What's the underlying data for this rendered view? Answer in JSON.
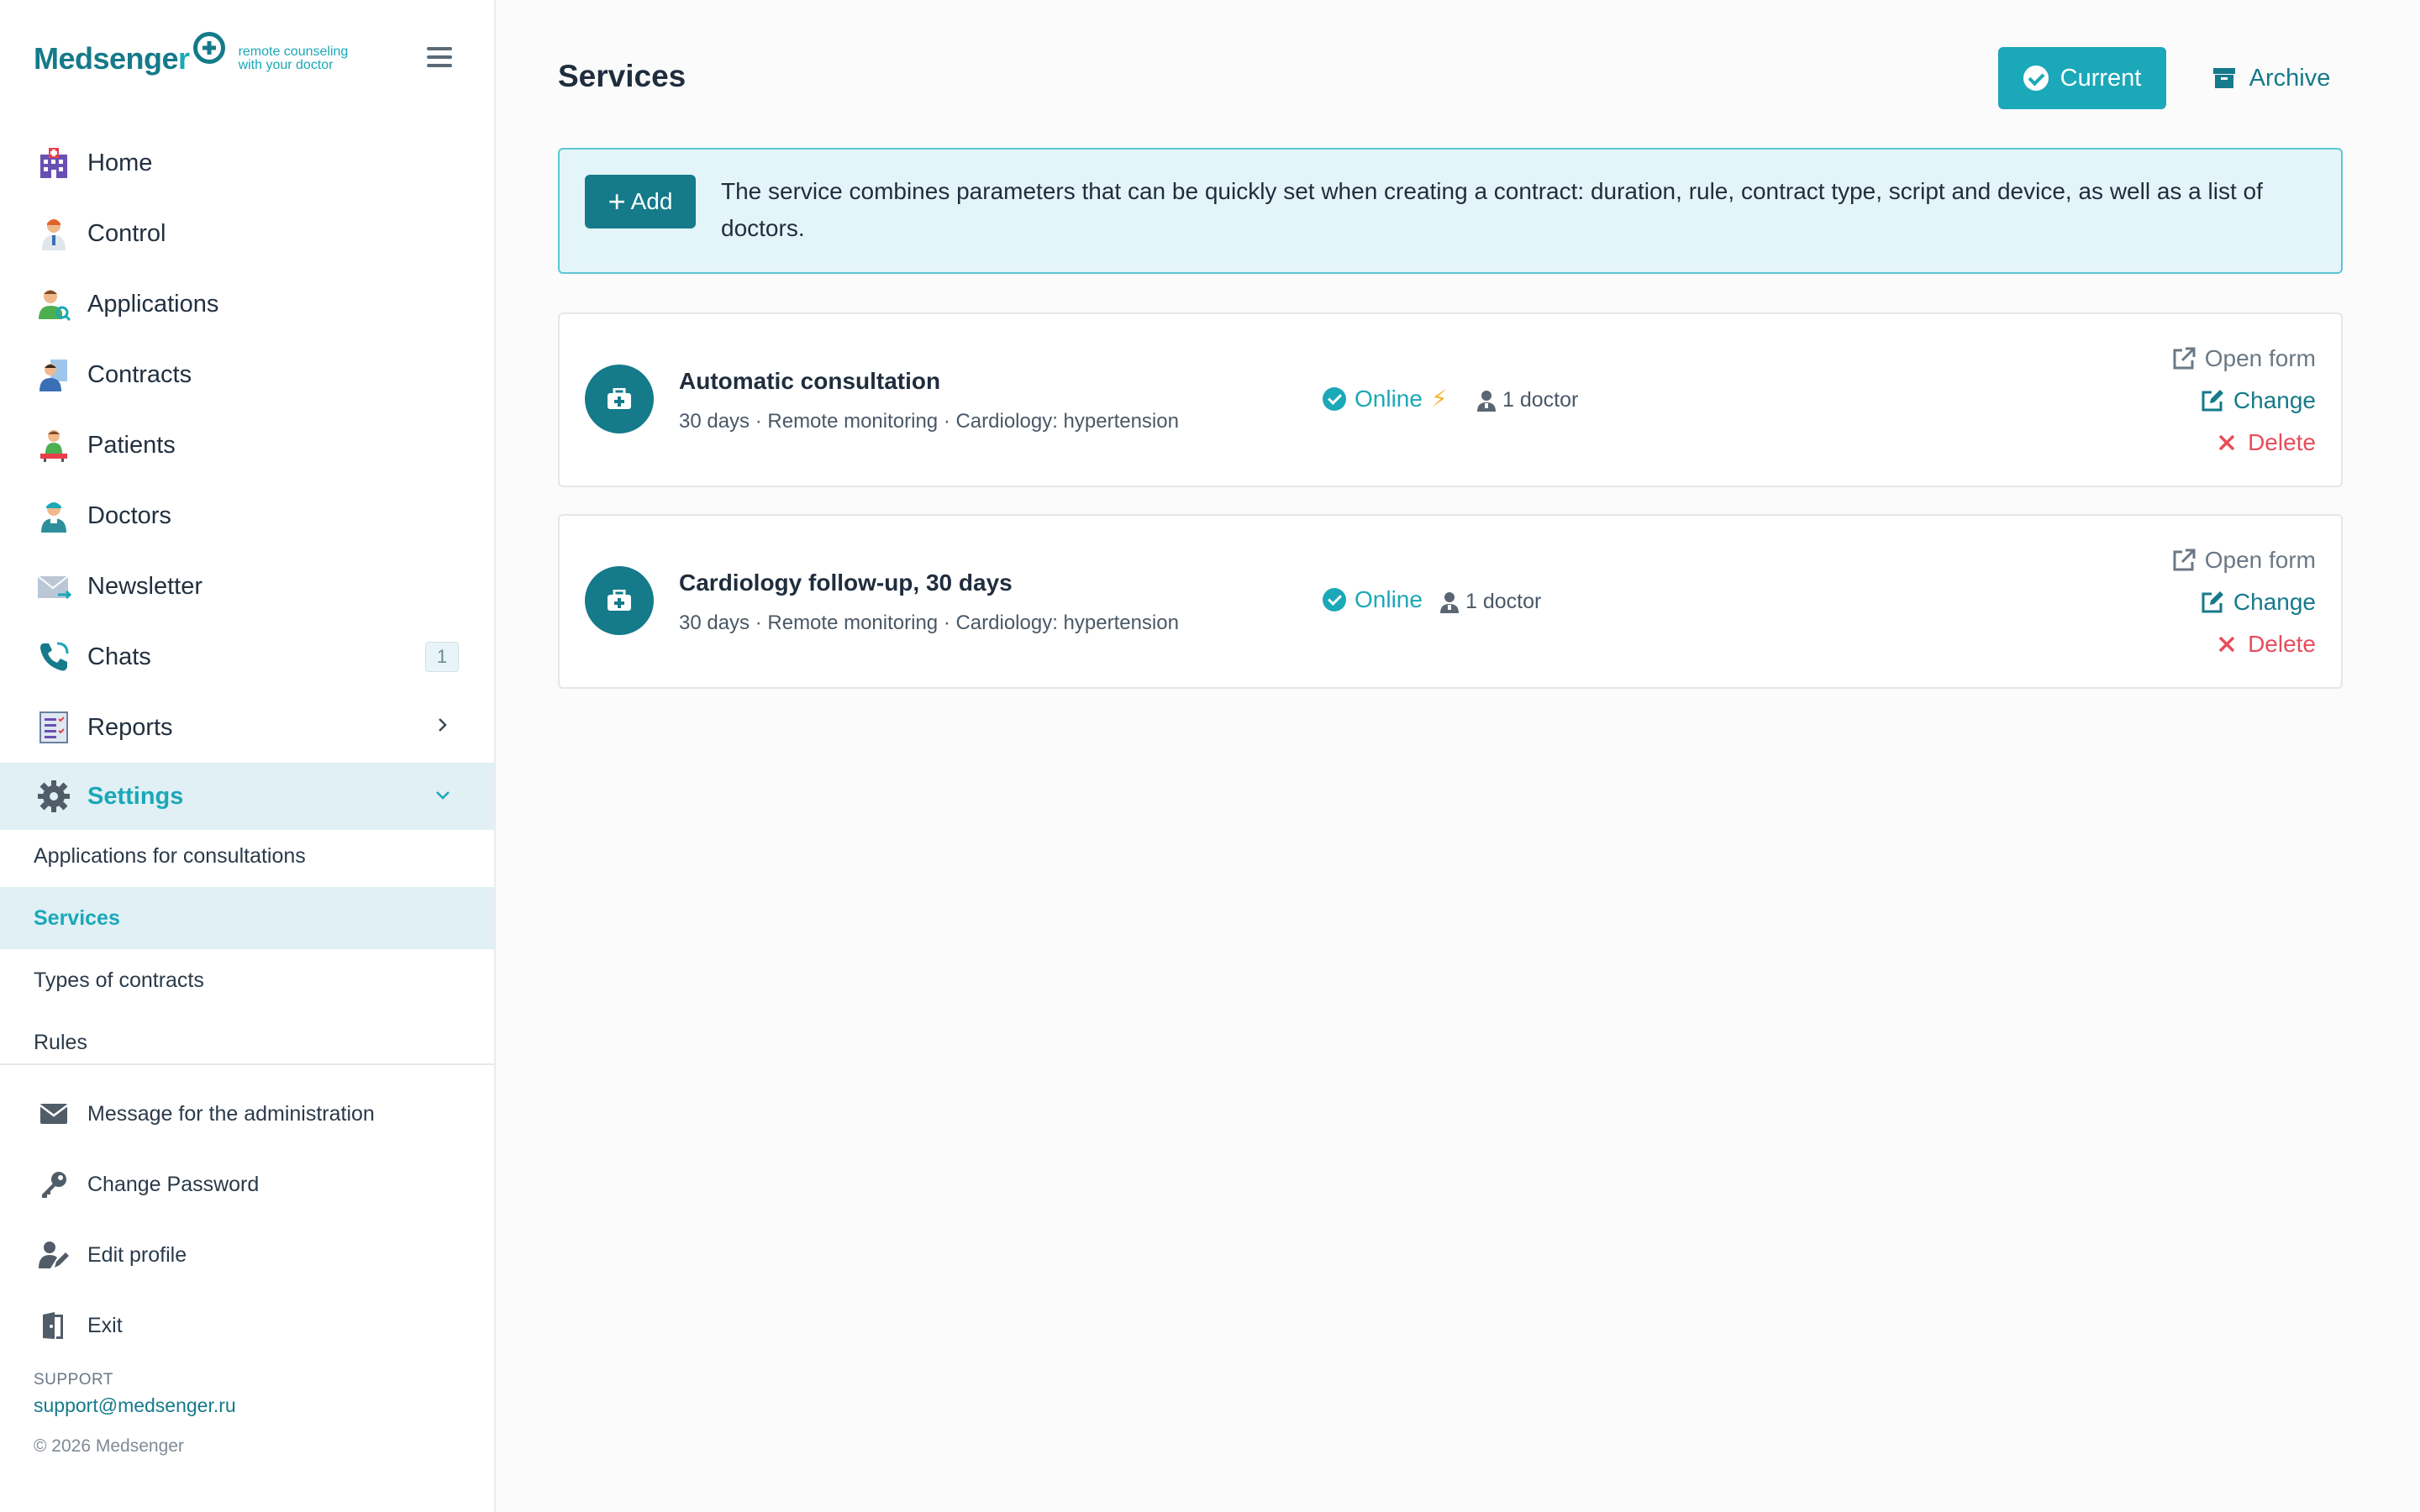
{
  "brand": {
    "name_part1": "Medsenge",
    "name_part2": "r",
    "tagline_line1": "remote counseling",
    "tagline_line2": "with your doctor"
  },
  "nav": {
    "items": [
      {
        "label": "Home",
        "icon": "hospital-icon"
      },
      {
        "label": "Control",
        "icon": "doctor-icon"
      },
      {
        "label": "Applications",
        "icon": "user-search-icon"
      },
      {
        "label": "Contracts",
        "icon": "contract-icon"
      },
      {
        "label": "Patients",
        "icon": "patient-icon"
      },
      {
        "label": "Doctors",
        "icon": "nurse-icon"
      },
      {
        "label": "Newsletter",
        "icon": "mail-icon"
      },
      {
        "label": "Chats",
        "icon": "phone-icon",
        "badge": "1"
      },
      {
        "label": "Reports",
        "icon": "report-icon"
      },
      {
        "label": "Settings",
        "icon": "gear-icon"
      }
    ],
    "settings_sub": [
      {
        "label": "Applications for consultations"
      },
      {
        "label": "Services"
      },
      {
        "label": "Types of contracts"
      },
      {
        "label": "Rules"
      }
    ],
    "aux": [
      {
        "label": "Message for the administration",
        "icon": "envelope-icon"
      },
      {
        "label": "Change Password",
        "icon": "key-icon"
      },
      {
        "label": "Edit profile",
        "icon": "user-edit-icon"
      },
      {
        "label": "Exit",
        "icon": "exit-icon"
      }
    ]
  },
  "support": {
    "caption": "SUPPORT",
    "email": "support@medsenger.ru",
    "copyright": "© 2026 Medsenger"
  },
  "main": {
    "title": "Services",
    "filters": {
      "current": "Current",
      "archive": "Archive"
    },
    "add_label": "Add",
    "info": "The service combines parameters that can be quickly set when creating a contract: duration, rule, contract type, script and device, as well as a list of doctors.",
    "services": [
      {
        "title": "Automatic consultation",
        "subtitle": "30 days · Remote monitoring · Cardiology: hypertension",
        "status": "Online",
        "doctors": "1 doctor",
        "actions": {
          "open": "Open form",
          "change": "Change",
          "delete": "Delete"
        }
      },
      {
        "title": "Cardiology follow-up, 30 days",
        "subtitle": "30 days · Remote monitoring · Cardiology: hypertension",
        "status": "Online",
        "doctors": "1 doctor",
        "actions": {
          "open": "Open form",
          "change": "Change",
          "delete": "Delete"
        }
      }
    ]
  },
  "colors": {
    "primary": "#157a8a",
    "accent": "#1ba8b8",
    "danger": "#e84d5b",
    "info_bg": "#e4f5f9",
    "active_nav_bg": "#e0f0f4"
  }
}
